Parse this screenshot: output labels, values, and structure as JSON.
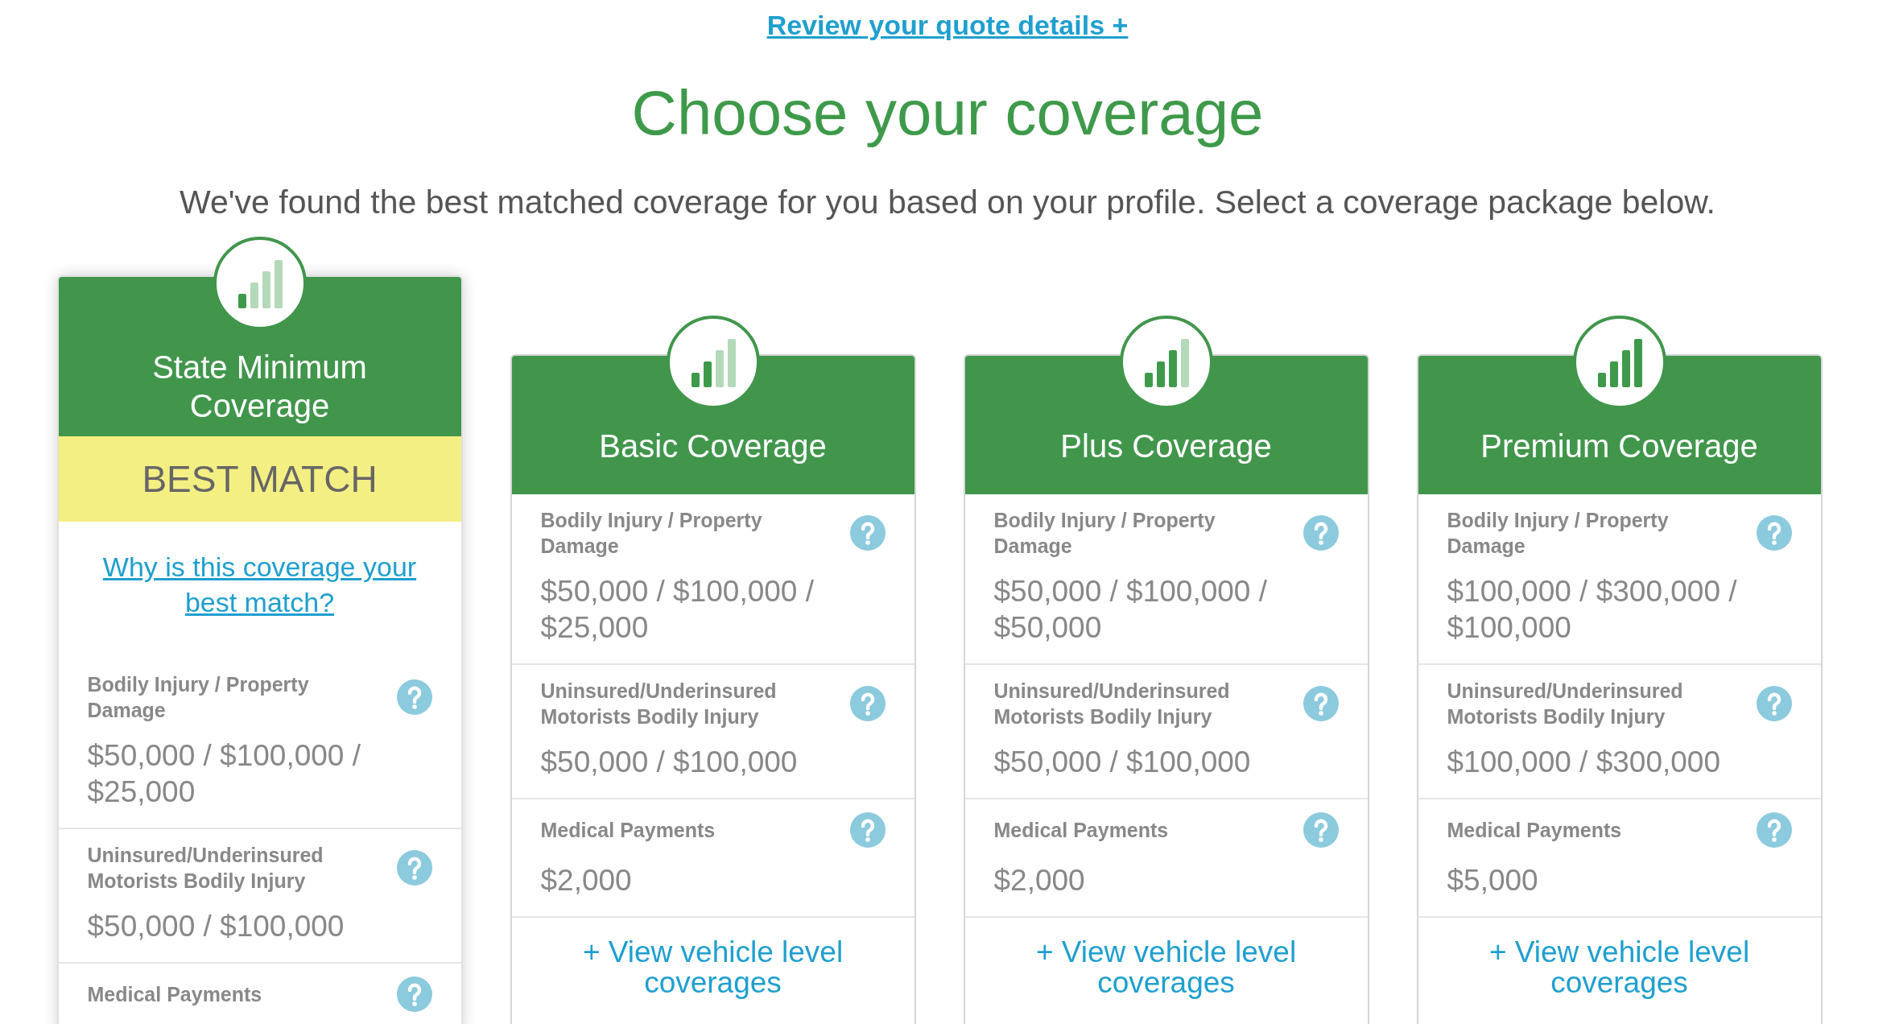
{
  "review_link": "Review your quote details +",
  "title": "Choose your coverage",
  "subtitle": "We've found the best matched coverage for you based on your profile. Select a coverage package below.",
  "packages": [
    {
      "name": "State Minimum Coverage",
      "bars": [
        {
          "filled": true
        },
        {
          "filled": false
        },
        {
          "filled": false
        },
        {
          "filled": false
        }
      ],
      "featured": true,
      "badge": "BEST MATCH",
      "why_link": "Why is this coverage your best match?",
      "coverages": [
        {
          "label": "Bodily Injury / Property Damage",
          "value": "$50,000 / $100,000 / $25,000"
        },
        {
          "label": "Uninsured/Underinsured Motorists Bodily Injury",
          "value": "$50,000 / $100,000"
        },
        {
          "label": "Medical Payments"
        }
      ]
    },
    {
      "name": "Basic Coverage",
      "bars": [
        {
          "filled": true
        },
        {
          "filled": true
        },
        {
          "filled": false
        },
        {
          "filled": false
        }
      ],
      "featured": false,
      "coverages": [
        {
          "label": "Bodily Injury / Property Damage",
          "value": "$50,000 / $100,000 / $25,000"
        },
        {
          "label": "Uninsured/Underinsured Motorists Bodily Injury",
          "value": "$50,000 / $100,000"
        },
        {
          "label": "Medical Payments",
          "value": "$2,000"
        }
      ],
      "vehicle_link": "+ View vehicle level coverages"
    },
    {
      "name": "Plus Coverage",
      "bars": [
        {
          "filled": true
        },
        {
          "filled": true
        },
        {
          "filled": true
        },
        {
          "filled": false
        }
      ],
      "featured": false,
      "coverages": [
        {
          "label": "Bodily Injury / Property Damage",
          "value": "$50,000 / $100,000 / $50,000"
        },
        {
          "label": "Uninsured/Underinsured Motorists Bodily Injury",
          "value": "$50,000 / $100,000"
        },
        {
          "label": "Medical Payments",
          "value": "$2,000"
        }
      ],
      "vehicle_link": "+ View vehicle level coverages"
    },
    {
      "name": "Premium Coverage",
      "bars": [
        {
          "filled": true
        },
        {
          "filled": true
        },
        {
          "filled": true
        },
        {
          "filled": true
        }
      ],
      "featured": false,
      "coverages": [
        {
          "label": "Bodily Injury / Property Damage",
          "value": "$100,000 / $300,000 / $100,000"
        },
        {
          "label": "Uninsured/Underinsured Motorists Bodily Injury",
          "value": "$100,000 / $300,000"
        },
        {
          "label": "Medical Payments",
          "value": "$5,000"
        }
      ],
      "vehicle_link": "+ View vehicle level coverages"
    }
  ]
}
